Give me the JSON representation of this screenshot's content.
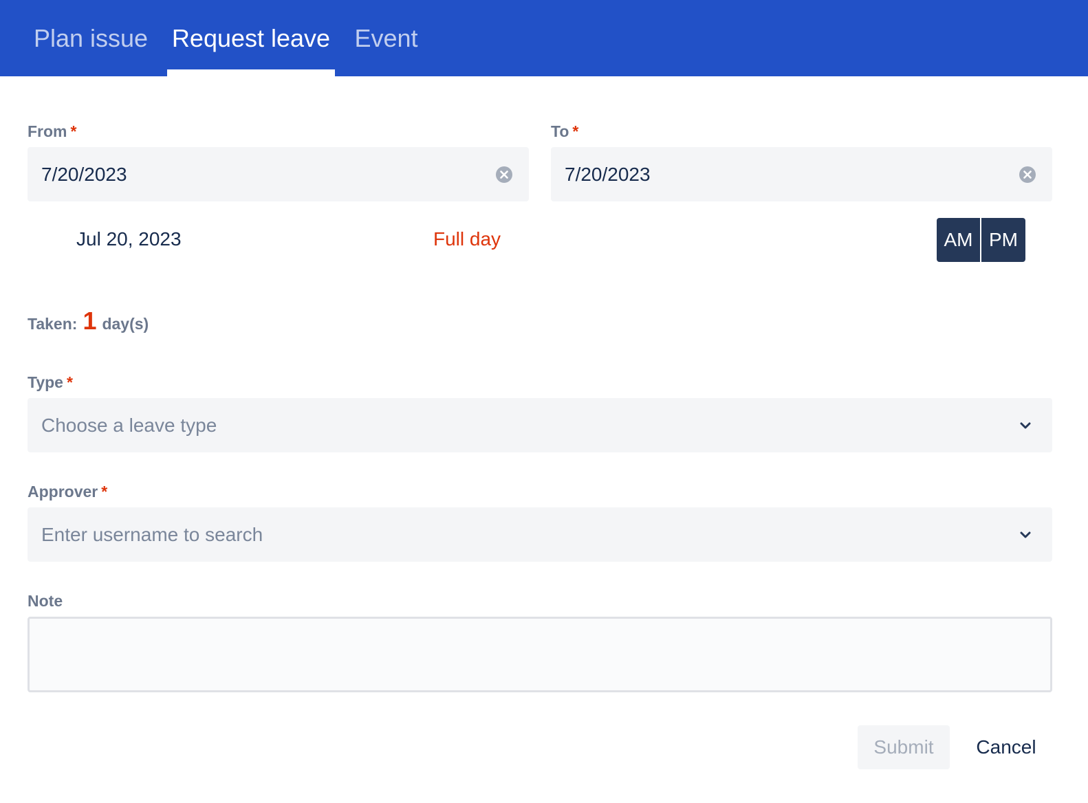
{
  "tabs": [
    {
      "label": "Plan issue"
    },
    {
      "label": "Request leave",
      "active": true
    },
    {
      "label": "Event"
    }
  ],
  "form": {
    "from": {
      "label": "From",
      "required_mark": "*",
      "value": "7/20/2023"
    },
    "to": {
      "label": "To",
      "required_mark": "*",
      "value": "7/20/2023"
    },
    "date_display": "Jul 20, 2023",
    "duration_option": "Full day",
    "am_label": "AM",
    "pm_label": "PM",
    "taken": {
      "prefix": "Taken:",
      "count": "1",
      "suffix": "day(s)"
    },
    "type": {
      "label": "Type",
      "required_mark": "*",
      "placeholder": "Choose a leave type"
    },
    "approver": {
      "label": "Approver",
      "required_mark": "*",
      "placeholder": "Enter username to search"
    },
    "note": {
      "label": "Note",
      "value": ""
    }
  },
  "actions": {
    "submit_label": "Submit",
    "cancel_label": "Cancel"
  },
  "colors": {
    "header_bg": "#2251c7",
    "required": "#de350b",
    "toggle_bg": "#253858",
    "field_bg": "#f4f5f7"
  },
  "icons": [
    "close-circle-icon",
    "chevron-down-icon"
  ]
}
